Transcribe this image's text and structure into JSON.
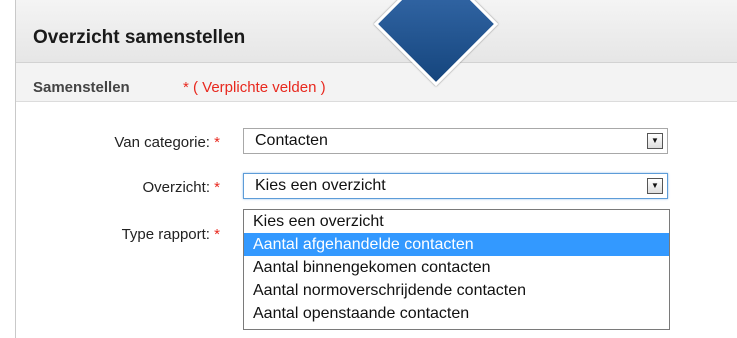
{
  "header": {
    "title": "Overzicht samenstellen"
  },
  "subheader": {
    "title": "Samenstellen",
    "required_note": "* ( Verplichte velden )"
  },
  "form": {
    "category": {
      "label": "Van categorie:",
      "required_mark": "*",
      "value": "Contacten"
    },
    "overview": {
      "label": "Overzicht:",
      "required_mark": "*",
      "value": "Kies een overzicht"
    },
    "report_type": {
      "label": "Type rapport:",
      "required_mark": "*"
    }
  },
  "dropdown": {
    "options": [
      "Kies een overzicht",
      "Aantal afgehandelde contacten",
      "Aantal binnengekomen contacten",
      "Aantal normoverschrijdende contacten",
      "Aantal openstaande contacten"
    ],
    "highlighted_index": 1
  },
  "colors": {
    "accent": "#3399ff",
    "required": "#e8281e",
    "pointer": "#1f5592"
  }
}
